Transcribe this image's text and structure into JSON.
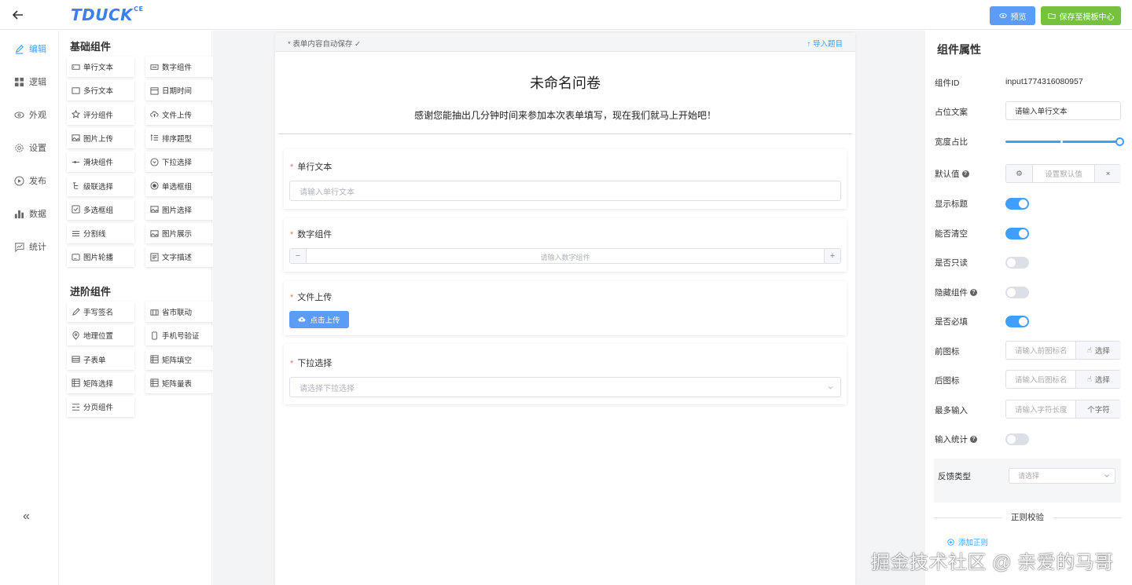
{
  "header": {
    "logo": "TDUCK",
    "logo_sup": "CE",
    "preview": "预览",
    "save_template": "保存至模板中心",
    "colors": {
      "primary": "#409eff",
      "success": "#74c23e"
    }
  },
  "nav": [
    {
      "label": "编辑",
      "icon": "edit-icon",
      "active": true
    },
    {
      "label": "逻辑",
      "icon": "grid-icon"
    },
    {
      "label": "外观",
      "icon": "eye-icon"
    },
    {
      "label": "设置",
      "icon": "gear-icon"
    },
    {
      "label": "发布",
      "icon": "play-icon"
    },
    {
      "label": "数据",
      "icon": "bar-chart-icon"
    },
    {
      "label": "统计",
      "icon": "stats-icon"
    }
  ],
  "collapse": "«",
  "components": {
    "basic_title": "基础组件",
    "basic": [
      "单行文本",
      "数字组件",
      "多行文本",
      "日期时间",
      "评分组件",
      "文件上传",
      "图片上传",
      "排序题型",
      "滑块组件",
      "下拉选择",
      "级联选择",
      "单选框组",
      "多选框组",
      "图片选择",
      "分割线",
      "图片展示",
      "图片轮播",
      "文字描述"
    ],
    "advanced_title": "进阶组件",
    "advanced": [
      "手写签名",
      "省市联动",
      "地理位置",
      "手机号验证",
      "子表单",
      "矩阵填空",
      "矩阵选择",
      "矩阵量表",
      "分页组件"
    ]
  },
  "form": {
    "autosave": "* 表单内容自动保存 ✓",
    "import": "↑ 导入题目",
    "title": "未命名问卷",
    "description": "感谢您能抽出几分钟时间来参加本次表单填写，现在我们就马上开始吧！",
    "fields": [
      {
        "label": "单行文本",
        "placeholder": "请输入单行文本"
      },
      {
        "label": "数字组件",
        "placeholder": "请输入数字组件",
        "minus": "−",
        "plus": "+"
      },
      {
        "label": "文件上传",
        "button": "点击上传"
      },
      {
        "label": "下拉选择",
        "placeholder": "请选择下拉选择"
      }
    ]
  },
  "props": {
    "title": "组件属性",
    "id_label": "组件ID",
    "id_value": "input1774316080957",
    "placeholder_label": "占位文案",
    "placeholder_value": "请输入单行文本",
    "width_label": "宽度占比",
    "width_value": 1.0,
    "default_label": "默认值",
    "default_placeholder": "设置默认值",
    "default_clear": "×",
    "show_title_label": "显示标题",
    "show_title": true,
    "clearable_label": "能否清空",
    "clearable": true,
    "readonly_label": "是否只读",
    "readonly": false,
    "hidden_label": "隐藏组件",
    "hidden": false,
    "required_label": "是否必填",
    "required": true,
    "prefix_label": "前图标",
    "prefix_placeholder": "请输入前图标名",
    "prefix_btn": "选择",
    "suffix_label": "后图标",
    "suffix_placeholder": "请输入后图标名",
    "suffix_btn": "选择",
    "maxlen_label": "最多输入",
    "maxlen_placeholder": "请输入字符长度",
    "maxlen_unit": "个字符",
    "count_label": "输入统计",
    "count": false,
    "feedback_label": "反馈类型",
    "feedback_placeholder": "请选择",
    "regex_title": "正则校验",
    "add_rule": "添加正则"
  },
  "watermark": "掘金技术社区 @ 亲爱的马哥"
}
